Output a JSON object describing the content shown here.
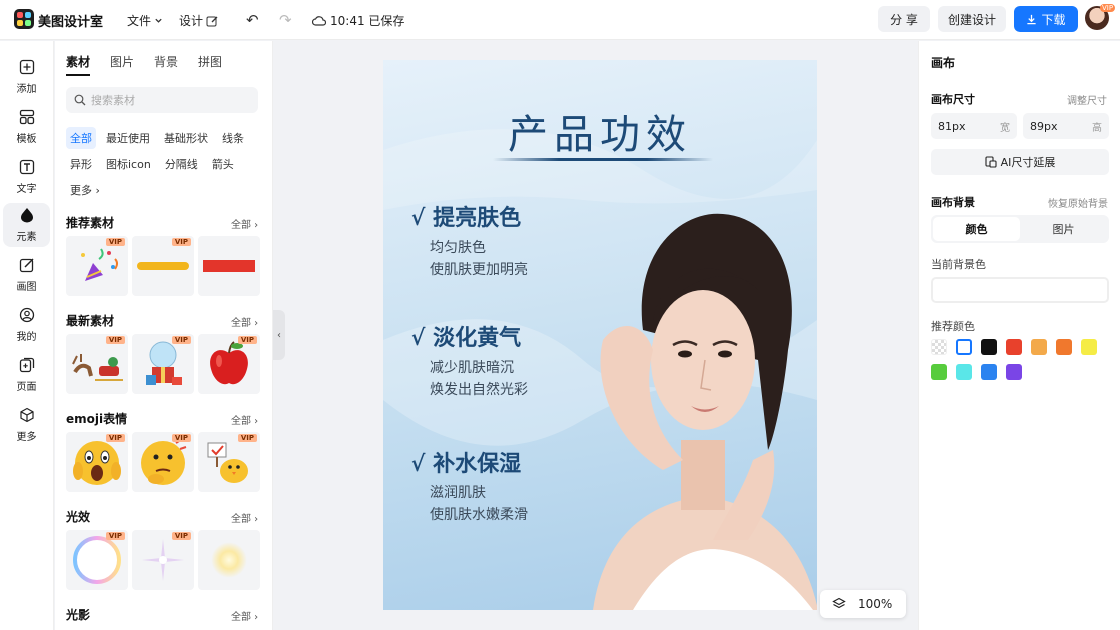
{
  "app": {
    "name": "美图设计室"
  },
  "topbar": {
    "menu_file": "文件",
    "menu_design": "设计",
    "saved_status": "10:41 已保存",
    "share_label": "分 享",
    "create_label": "创建设计",
    "download_label": "下载",
    "avatar_badge": "VIP"
  },
  "rail": {
    "items": [
      {
        "label": "添加",
        "icon": "+"
      },
      {
        "label": "模板",
        "icon": "▦"
      },
      {
        "label": "文字",
        "icon": "T"
      },
      {
        "label": "元素",
        "icon": "◆"
      },
      {
        "label": "画图",
        "icon": "✎"
      },
      {
        "label": "我的",
        "icon": "☺"
      },
      {
        "label": "页面",
        "icon": "⊞"
      },
      {
        "label": "更多",
        "icon": "⬡"
      }
    ]
  },
  "panel": {
    "tabs": [
      "素材",
      "图片",
      "背景",
      "拼图"
    ],
    "search_placeholder": "搜索素材",
    "chips": [
      "全部",
      "最近使用",
      "基础形状",
      "线条",
      "异形",
      "图标icon",
      "分隔线",
      "箭头",
      "更多"
    ],
    "all_label": "全部",
    "vip_label": "VIP",
    "sections": [
      {
        "title": "推荐素材"
      },
      {
        "title": "最新素材"
      },
      {
        "title": "emoji表情"
      },
      {
        "title": "光效"
      },
      {
        "title": "光影"
      }
    ]
  },
  "canvas": {
    "title": "产品功效",
    "features": [
      {
        "title": "√ 提亮肤色",
        "lines": [
          "均匀肤色",
          "使肌肤更加明亮"
        ]
      },
      {
        "title": "√ 淡化黄气",
        "lines": [
          "减少肌肤暗沉",
          "焕发出自然光彩"
        ]
      },
      {
        "title": "√ 补水保湿",
        "lines": [
          "滋润肌肤",
          "使肌肤水嫩柔滑"
        ]
      }
    ],
    "zoom": "100%"
  },
  "right": {
    "title": "画布",
    "size_label": "画布尺寸",
    "adjust_label": "调整尺寸",
    "width_value": "81px",
    "width_unit": "宽",
    "height_value": "89px",
    "height_unit": "高",
    "ai_btn": "AI尺寸延展",
    "bg_label": "画布背景",
    "bg_reset": "恢复原始背景",
    "seg_color": "颜色",
    "seg_image": "图片",
    "current_bg": "当前背景色",
    "recommend": "推荐颜色",
    "swatches": [
      "transparent",
      "#ffffff",
      "#111111",
      "#e8412c",
      "#f3a94a",
      "#f0782d",
      "#f5ec46",
      "#57cc3d",
      "#5ae6e8",
      "#2b83f0",
      "#7a45e6"
    ]
  }
}
